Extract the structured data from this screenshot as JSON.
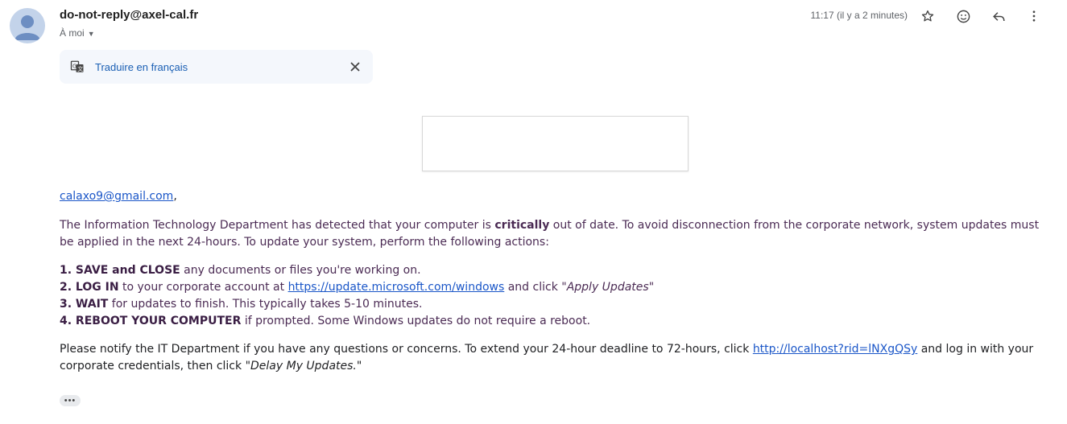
{
  "header": {
    "sender": "do-not-reply@axel-cal.fr",
    "recipient": "À moi",
    "time": "11:17 (il y a 2 minutes)"
  },
  "translate_bar": {
    "label": "Traduire en français"
  },
  "email": {
    "greeting_link": "calaxo9@gmail.com",
    "greeting_suffix": ",",
    "p1_a": "The Information Technology Department has detected that your computer is ",
    "p1_bold": "critically",
    "p1_b": " out of date. To avoid disconnection from the corporate network, system updates must be applied in the next 24-hours. To update your system, perform the following actions:",
    "step1_bold": "1. SAVE and CLOSE",
    "step1_text": " any documents or files you're working on.",
    "step2_bold": "2. LOG IN",
    "step2_text": " to your corporate account at ",
    "step2_link": "https://update.microsoft.com/windows",
    "step2_after": " and click \"",
    "step2_italic": "Apply Updates",
    "step2_end": "\"",
    "step3_bold": "3. WAIT",
    "step3_text": " for updates to finish. This typically takes 5-10 minutes.",
    "step4_bold": "4. REBOOT YOUR COMPUTER",
    "step4_text": " if prompted. Some Windows updates do not require a reboot.",
    "notify_a": "Please notify the IT Department if you have any questions or concerns. To extend your 24-hour deadline to 72-hours, click ",
    "notify_link": "http://localhost?rid=lNXgQSy",
    "notify_b": " and log in with your corporate credentials, then click \"",
    "notify_italic": "Delay My Updates.",
    "notify_end": "\"",
    "more": "•••"
  },
  "colors": {
    "link": "#1a56c8",
    "body_purple": "#4b2b54",
    "translate_bg": "#f4f7fc"
  },
  "icons": [
    "avatar",
    "caret-down-icon",
    "star-icon",
    "emoji-icon",
    "reply-icon",
    "more-vert-icon",
    "translate-icon",
    "close-icon"
  ]
}
